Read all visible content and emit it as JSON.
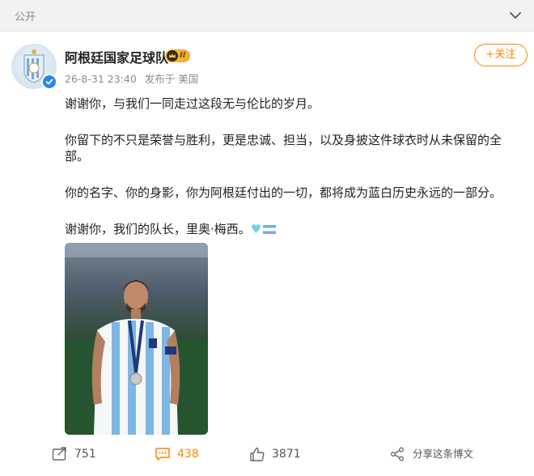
{
  "topbar": {
    "visibility": "公开"
  },
  "author": {
    "name": "阿根廷国家足球队",
    "badge_text": "II",
    "date": "26-8-31 23:40",
    "source": "发布于 美国",
    "follow_label": "+关注"
  },
  "post": {
    "paragraphs": [
      "谢谢你，与我们一同走过这段无与伦比的岁月。",
      "你留下的不只是荣誉与胜利，更是忠诚、担当，以及身披这件球衣时从未保留的全部。",
      "你的名字、你的身影，你为阿根廷付出的一切，都将成为蓝白历史永远的一部分。",
      "谢谢你，我们的队长，里奥·梅西。"
    ],
    "emoji": [
      "light-blue-heart",
      "argentina-flag"
    ]
  },
  "actions": {
    "repost": "751",
    "comment": "438",
    "like": "3871",
    "share": "分享这条博文"
  },
  "colors": {
    "accent": "#ff8200",
    "verified": "#2a88e6",
    "argentina_blue": "#74acdf"
  }
}
